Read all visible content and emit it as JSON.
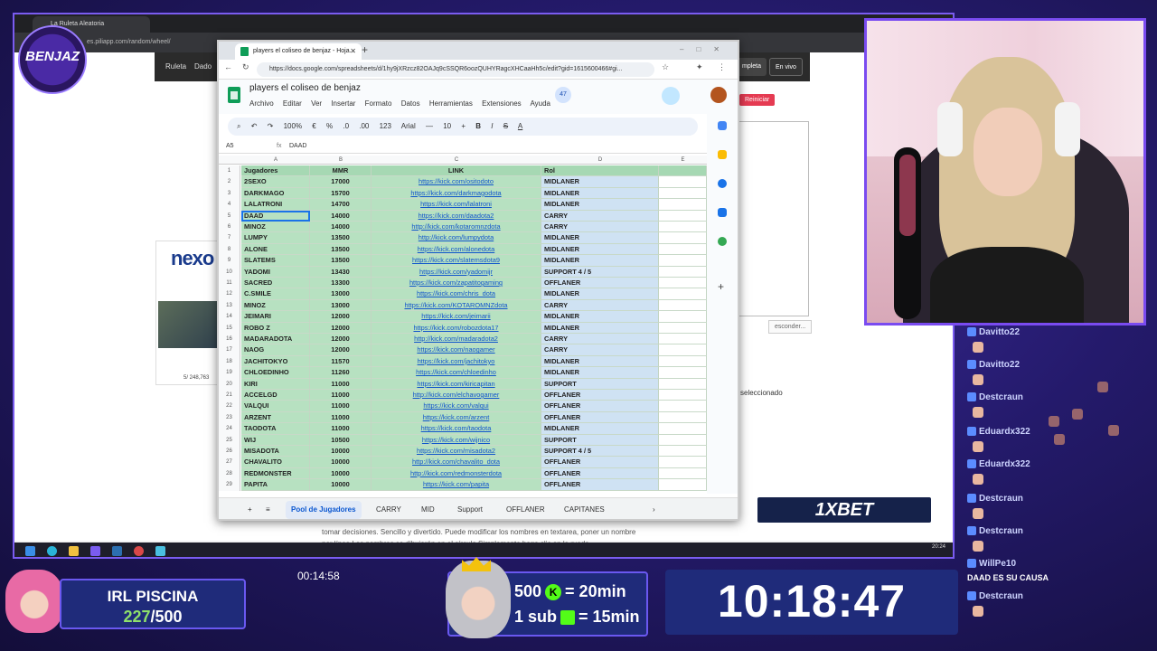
{
  "background_browser": {
    "tab_title": "La Ruleta Aleatoria",
    "url": "es.piliapp.com/random/wheel/",
    "nav_items": [
      "Ruleta",
      "Dado"
    ],
    "nav_buttons": [
      "mpleta",
      "En vivo"
    ],
    "reiniciar": "Reiniciar",
    "esconder": "esconder...",
    "seleccionado": "seleccionado",
    "ad_logo": "nexo",
    "ad_count": "5/ 248,763",
    "description": "tomar decisiones. Sencillo y divertido. Puede modificar los nombres en textarea, poner un nombre por línea.Los nombres se dibujarán en el círculo.Simplemente haga clic en la rueda"
  },
  "taskbar": {
    "clock": "20:24"
  },
  "sheets": {
    "tab_title": "players el coliseo de benjaz - Hoja...",
    "url": "https://docs.google.com/spreadsheets/d/1hy9jXRzcz82OAJq9cSSQR6oozQUHYRagcXHCaaHh5c/edit?gid=1615600466#gi...",
    "doc_title": "players el coliseo de benjaz",
    "menu": [
      "Archivo",
      "Editar",
      "Ver",
      "Insertar",
      "Formato",
      "Datos",
      "Herramientas",
      "Extensiones",
      "Ayuda"
    ],
    "badge": "47",
    "toolbar": [
      "100%",
      "€",
      "%",
      ".0",
      ".00",
      "123",
      "Arial",
      "—",
      "10",
      "+",
      "B",
      "I",
      "S",
      "A"
    ],
    "cell_ref": "A5",
    "formula_value": "DAAD",
    "col_letters": [
      "A",
      "B",
      "C",
      "D",
      "E"
    ],
    "headers": [
      "Jugadores",
      "MMR",
      "LINK",
      "Rol"
    ],
    "rows": [
      {
        "n": "2",
        "name": "2SEXO",
        "mmr": "17000",
        "link": "https://kick.com/ositodoto",
        "rol": "MIDLANER"
      },
      {
        "n": "3",
        "name": "DARKMAGO",
        "mmr": "15700",
        "link": "https://kick.com/darkmagodota",
        "rol": "MIDLANER"
      },
      {
        "n": "4",
        "name": "LALATRONI",
        "mmr": "14700",
        "link": "https://kick.com/lalatroni",
        "rol": "MIDLANER"
      },
      {
        "n": "5",
        "name": "DAAD",
        "mmr": "14000",
        "link": "https://kick.com/daadota2",
        "rol": "CARRY"
      },
      {
        "n": "6",
        "name": "MINOZ",
        "mmr": "14000",
        "link": "http://kick.com/kotaromnzdota",
        "rol": "CARRY"
      },
      {
        "n": "7",
        "name": "LUMPY",
        "mmr": "13500",
        "link": "http://kick.com/lumpydota",
        "rol": "MIDLANER"
      },
      {
        "n": "8",
        "name": "ALONE",
        "mmr": "13500",
        "link": "https://kick.com/alonedota",
        "rol": "MIDLANER"
      },
      {
        "n": "9",
        "name": "SLATEMS",
        "mmr": "13500",
        "link": "https://kick.com/slatemsdota9",
        "rol": "MIDLANER"
      },
      {
        "n": "10",
        "name": "YADOMI",
        "mmr": "13430",
        "link": "https://kick.com/yadomijr",
        "rol": "SUPPORT 4 / 5"
      },
      {
        "n": "11",
        "name": "SACRED",
        "mmr": "13300",
        "link": "https://kick.com/zapatitogaming",
        "rol": "OFFLANER"
      },
      {
        "n": "12",
        "name": "C.SMILE",
        "mmr": "13000",
        "link": "https://kick.com/chris_dota",
        "rol": "MIDLANER"
      },
      {
        "n": "13",
        "name": "MINOZ",
        "mmr": "13000",
        "link": "https://kick.com/KOTAROMNZdota",
        "rol": "CARRY"
      },
      {
        "n": "14",
        "name": "JEIMARI",
        "mmr": "12000",
        "link": "https://kick.com/jeimarii",
        "rol": "MIDLANER"
      },
      {
        "n": "15",
        "name": "ROBO Z",
        "mmr": "12000",
        "link": "https://kick.com/robozdota17",
        "rol": "MIDLANER"
      },
      {
        "n": "16",
        "name": "MADARADOTA",
        "mmr": "12000",
        "link": "http://kick.com/madaradota2",
        "rol": "CARRY"
      },
      {
        "n": "17",
        "name": "NAOG",
        "mmr": "12000",
        "link": "https://kick.com/naogamer",
        "rol": "CARRY"
      },
      {
        "n": "18",
        "name": "JACHITOKYO",
        "mmr": "11570",
        "link": "https://kick.com/jachitokyo",
        "rol": "MIDLANER"
      },
      {
        "n": "19",
        "name": "CHLOEDINHO",
        "mmr": "11260",
        "link": "https://kick.com/chloedinho",
        "rol": "MIDLANER"
      },
      {
        "n": "20",
        "name": "KIRI",
        "mmr": "11000",
        "link": "https://kick.com/kiricapitan",
        "rol": "SUPPORT"
      },
      {
        "n": "21",
        "name": "ACCELGD",
        "mmr": "11000",
        "link": "http://kick.com/elchavogamer",
        "rol": "OFFLANER"
      },
      {
        "n": "22",
        "name": "VALQUI",
        "mmr": "11000",
        "link": "https://kick.com/valqui",
        "rol": "OFFLANER"
      },
      {
        "n": "23",
        "name": "ARZENT",
        "mmr": "11000",
        "link": "https://kick.com/arzent",
        "rol": "OFFLANER"
      },
      {
        "n": "24",
        "name": "TAODOTA",
        "mmr": "11000",
        "link": "https://kick.com/taodota",
        "rol": "MIDLANER"
      },
      {
        "n": "25",
        "name": "WIJ",
        "mmr": "10500",
        "link": "https://kick.com/wijnico",
        "rol": "SUPPORT"
      },
      {
        "n": "26",
        "name": "MISADOTA",
        "mmr": "10000",
        "link": "https://kick.com/misadota2",
        "rol": "SUPPORT 4 / 5"
      },
      {
        "n": "27",
        "name": "CHAVALITO",
        "mmr": "10000",
        "link": "http://kick.com/chavalito_dota",
        "rol": "OFFLANER"
      },
      {
        "n": "28",
        "name": "REDMONSTER",
        "mmr": "10000",
        "link": "http://kick.com/redmonsterdota",
        "rol": "OFFLANER"
      },
      {
        "n": "29",
        "name": "PAPITA",
        "mmr": "10000",
        "link": "https://kick.com/papita",
        "rol": "OFFLANER"
      }
    ],
    "sheet_tabs": [
      "Pool de Jugadores",
      "CARRY",
      "MID",
      "Support",
      "OFFLANER",
      "CAPITANES"
    ]
  },
  "chat": [
    {
      "user": "Davitto22",
      "message": ""
    },
    {
      "user": "Davitto22",
      "message": ""
    },
    {
      "user": "Destcraun",
      "message": ""
    },
    {
      "user": "Eduardx322",
      "message": ""
    },
    {
      "user": "Eduardx322",
      "message": ""
    },
    {
      "user": "Destcraun",
      "message": ""
    },
    {
      "user": "Destcraun",
      "message": ""
    },
    {
      "user": "WillPe10",
      "message": "DAAD ES SU CAUSA"
    },
    {
      "user": "Destcraun",
      "message": ""
    }
  ],
  "overlay": {
    "channel_logo": "BENJAZ",
    "goal_title": "IRL PISCINA",
    "goal_current": "227",
    "goal_total": "/500",
    "goal_timer": "00:14:58",
    "promo_line1_a": "500",
    "promo_line1_b": "= 20min",
    "promo_line2_a": "1 sub",
    "promo_line2_b": "= 15min",
    "clock": "10:18:47",
    "bet_banner": "1XBET"
  }
}
